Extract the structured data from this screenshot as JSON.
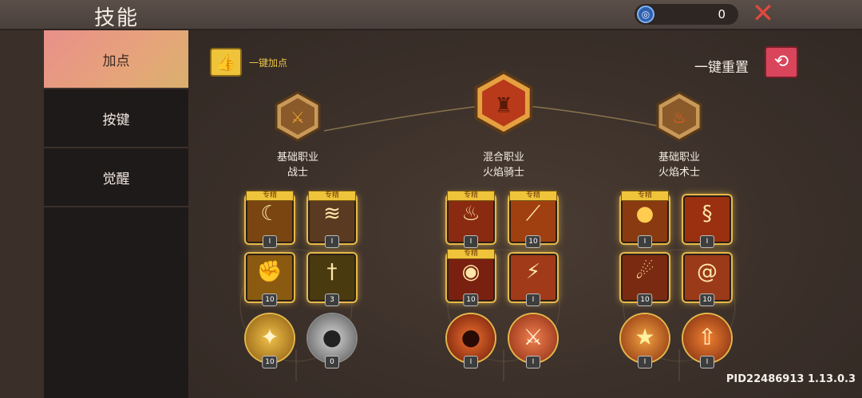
{
  "header": {
    "title": "技能",
    "currency_value": "0"
  },
  "sidebar": {
    "items": [
      {
        "label": "加点"
      },
      {
        "label": "按键"
      },
      {
        "label": "觉醒"
      }
    ]
  },
  "toolbar": {
    "auto_label": "一键加点",
    "reset_label": "一键重置"
  },
  "spec_label": "专精",
  "classes": [
    {
      "type": "基础职业",
      "name": "战士",
      "skills": [
        {
          "level": "I",
          "spec": true,
          "icon": "slash-icon"
        },
        {
          "level": "I",
          "spec": true,
          "icon": "claw-icon"
        },
        {
          "level": "10",
          "spec": false,
          "icon": "fist-icon"
        },
        {
          "level": "3",
          "spec": false,
          "icon": "sword-ground-icon"
        },
        {
          "level": "10",
          "spec": false,
          "icon": "sword-burst-icon"
        },
        {
          "level": "0",
          "spec": false,
          "icon": "hood-icon"
        }
      ]
    },
    {
      "type": "混合职业",
      "name": "火焰骑士",
      "skills": [
        {
          "level": "I",
          "spec": true,
          "icon": "fire-dragon-icon"
        },
        {
          "level": "10",
          "spec": true,
          "icon": "fire-beam-icon"
        },
        {
          "level": "10",
          "spec": true,
          "icon": "fire-circle-icon"
        },
        {
          "level": "I",
          "spec": false,
          "icon": "fire-slash-icon"
        },
        {
          "level": "I",
          "spec": false,
          "icon": "fire-face-icon"
        },
        {
          "level": "I",
          "spec": false,
          "icon": "fire-sword-icon"
        }
      ]
    },
    {
      "type": "基础职业",
      "name": "火焰术士",
      "skills": [
        {
          "level": "I",
          "spec": true,
          "icon": "fire-orb-icon"
        },
        {
          "level": "I",
          "spec": false,
          "icon": "fire-serpent-icon"
        },
        {
          "level": "10",
          "spec": false,
          "icon": "meteor-icon"
        },
        {
          "level": "10",
          "spec": false,
          "icon": "fire-swirl-icon"
        },
        {
          "level": "I",
          "spec": false,
          "icon": "star-burst-icon"
        },
        {
          "level": "I",
          "spec": false,
          "icon": "fire-arrow-icon"
        }
      ]
    }
  ],
  "version_text": "PID22486913 1.13.0.3"
}
